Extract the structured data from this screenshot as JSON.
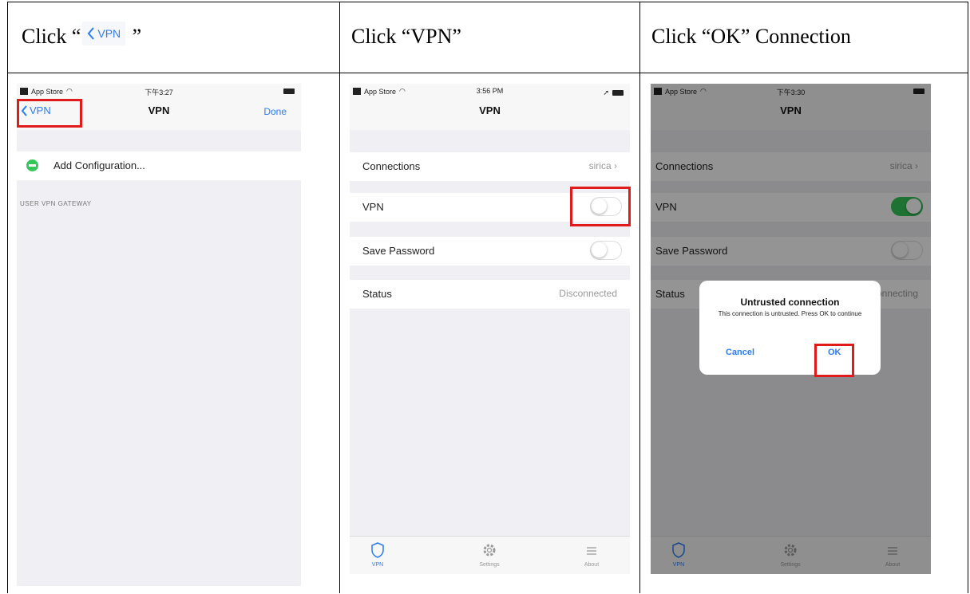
{
  "headers": {
    "col1_prefix": "Click “",
    "col1_chip": "VPN",
    "col1_suffix": " ”",
    "col2": "Click “VPN”",
    "col3": "Click “OK” Connection"
  },
  "screen1": {
    "carrier": "App Store",
    "time": "下午3:27",
    "back_label": "VPN",
    "nav_title": "VPN",
    "done_label": "Done",
    "add_config_label": "Add Configuration...",
    "section_label": "USER VPN GATEWAY"
  },
  "screen2": {
    "carrier": "App Store",
    "time": "3:56 PM",
    "nav_title": "VPN",
    "connections_label": "Connections",
    "connections_value": "sirica",
    "vpn_label": "VPN",
    "save_password_label": "Save Password",
    "status_label": "Status",
    "status_value": "Disconnected",
    "tab_vpn": "VPN",
    "tab_settings": "Settings",
    "tab_about": "About"
  },
  "screen3": {
    "carrier": "App Store",
    "time": "下午3:30",
    "nav_title": "VPN",
    "connections_label": "Connections",
    "connections_value": "sirica",
    "vpn_label": "VPN",
    "save_password_label": "Save Password",
    "status_label": "Status",
    "status_value": "Connecting",
    "alert_title": "Untrusted connection",
    "alert_message": "This connection is untrusted. Press OK to continue",
    "alert_cancel": "Cancel",
    "alert_ok": "OK",
    "tab_vpn": "VPN",
    "tab_settings": "Settings",
    "tab_about": "About"
  },
  "colors": {
    "ios_blue": "#2c7cf2",
    "toggle_on": "#35c759",
    "highlight_red": "#e01b1b"
  }
}
